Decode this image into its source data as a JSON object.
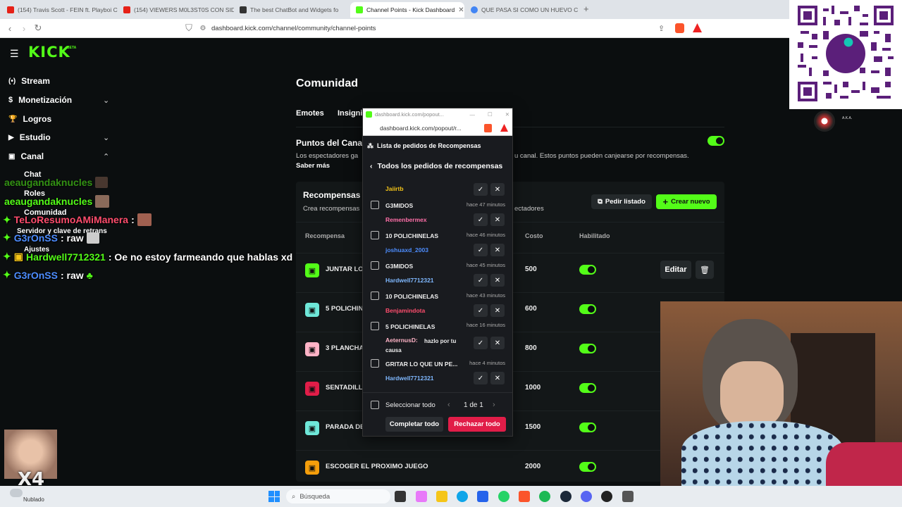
{
  "browser": {
    "tabs": [
      {
        "label": "(154) Travis Scott - FEIN ft. Playboi C",
        "color": "#e62117"
      },
      {
        "label": "(154) VIEWERS M0L3ST0S CON SID",
        "color": "#e62117"
      },
      {
        "label": "The best ChatBot and Widgets fo",
        "color": "#333333"
      },
      {
        "label": "Channel Points - Kick Dashboard",
        "color": "#53fc18"
      },
      {
        "label": "QUE PASA SI COMO UN HUEVO CRU",
        "color": "#4285f4"
      }
    ],
    "url": "dashboard.kick.com/channel/community/channel-points"
  },
  "sidebar": {
    "logo": "KICK",
    "beta": "BETA",
    "items": [
      {
        "label": "Stream",
        "icon": "stream-icon"
      },
      {
        "label": "Monetización",
        "icon": "dollar-icon"
      },
      {
        "label": "Logros",
        "icon": "trophy-icon"
      },
      {
        "label": "Estudio",
        "icon": "video-icon"
      },
      {
        "label": "Canal",
        "icon": "channel-icon"
      }
    ],
    "subitems": [
      "Chat",
      "Roles",
      "Comunidad",
      "Servidor y clave de retrans",
      "Ajustes"
    ]
  },
  "chat": [
    {
      "user": "aeaugandaknucles",
      "color": "#53fc18",
      "text": ""
    },
    {
      "user": "aeaugandaknucles",
      "color": "#53fc18",
      "text": ""
    },
    {
      "user": "TeLoResumoAMiManera",
      "color": "#ff4d6d",
      "text": ""
    },
    {
      "user": "G3rOnSS",
      "color": "#4d8dff",
      "text": ": raw"
    },
    {
      "user": "Hardwell7712321",
      "color": "#53fc18",
      "text": ": Oe no estoy farmeando que hablas xd"
    },
    {
      "user": "G3rOnSS",
      "color": "#4d8dff",
      "text": ": raw"
    }
  ],
  "main": {
    "title": "Comunidad",
    "tabs": [
      "Emotes",
      "Insigni"
    ],
    "points_title": "Puntos del Cana",
    "points_desc_left": "Los espectadores ga",
    "points_desc_right": "u canal. Estos puntos pueden canjearse por recompensas.",
    "learn_more": "Saber más",
    "rewards_title": "Recompensas",
    "rewards_sub_left": "Crea recompensas",
    "rewards_sub_right": "ectadores",
    "request_list_button": "Pedir listado",
    "create_button": "Crear nuevo",
    "columns": {
      "reward": "Recompensa",
      "cost": "Costo",
      "enabled": "Habilitado"
    },
    "edit_button": "Editar",
    "rewards": [
      {
        "name": "JUNTAR LO",
        "cost": "500",
        "color": "#53fc18",
        "enabled": true
      },
      {
        "name": "5 POLICHIN",
        "cost": "600",
        "color": "#6ee7d8",
        "enabled": true
      },
      {
        "name": "3 PLANCHA",
        "cost": "800",
        "color": "#ffb3c6",
        "enabled": true
      },
      {
        "name": "SENTADILL",
        "cost": "1000",
        "color": "#e11d48",
        "enabled": true
      },
      {
        "name": "PARADA DE",
        "cost": "1500",
        "color": "#6ee7d8",
        "enabled": true
      },
      {
        "name": "ESCOGER EL PROXIMO JUEGO",
        "cost": "2000",
        "color": "#f59e0b",
        "enabled": true
      }
    ]
  },
  "popup": {
    "window_title": "dashboard.kick.com/popout...",
    "url": "dashboard.kick.com/popout/r...",
    "header": "Lista de pedidos de Recompensas",
    "back_label": "Todos los pedidos de recompensas",
    "first_user": "Jaiirtb",
    "requests": [
      {
        "title": "G3MIDOS",
        "time": "hace 47 minutos",
        "user": "Remenbermex",
        "user_color": "#ff6fa8",
        "message": ""
      },
      {
        "title": "10 POLICHINELAS",
        "time": "hace 46 minutos",
        "user": "joshuaxd_2003",
        "user_color": "#4d8dff",
        "message": ""
      },
      {
        "title": "G3MIDOS",
        "time": "hace 45 minutos",
        "user": "Hardwell7712321",
        "user_color": "#7fb8ff",
        "message": ""
      },
      {
        "title": "10 POLICHINELAS",
        "time": "hace 43 minutos",
        "user": "Benjamindota",
        "user_color": "#ff4d6d",
        "message": ""
      },
      {
        "title": "5 POLICHINELAS",
        "time": "hace 16 minutos",
        "user": "AeternusD:",
        "user_color": "#ffb3c6",
        "message": "hazlo por tu causa"
      },
      {
        "title": "GRITAR LO QUE UN PE...",
        "time": "hace 4 minutos",
        "user": "Hardwell7712321",
        "user_color": "#7fb8ff",
        "message": ""
      }
    ],
    "select_all": "Seleccionar todo",
    "pagination": "1 de 1",
    "complete_all": "Completar todo",
    "reject_all": "Rechazar todo"
  },
  "overlay": {
    "aka_label": "A.K.A.",
    "multiplier": "X4"
  },
  "taskbar": {
    "weather": "Nublado",
    "search": "Búsqueda"
  }
}
